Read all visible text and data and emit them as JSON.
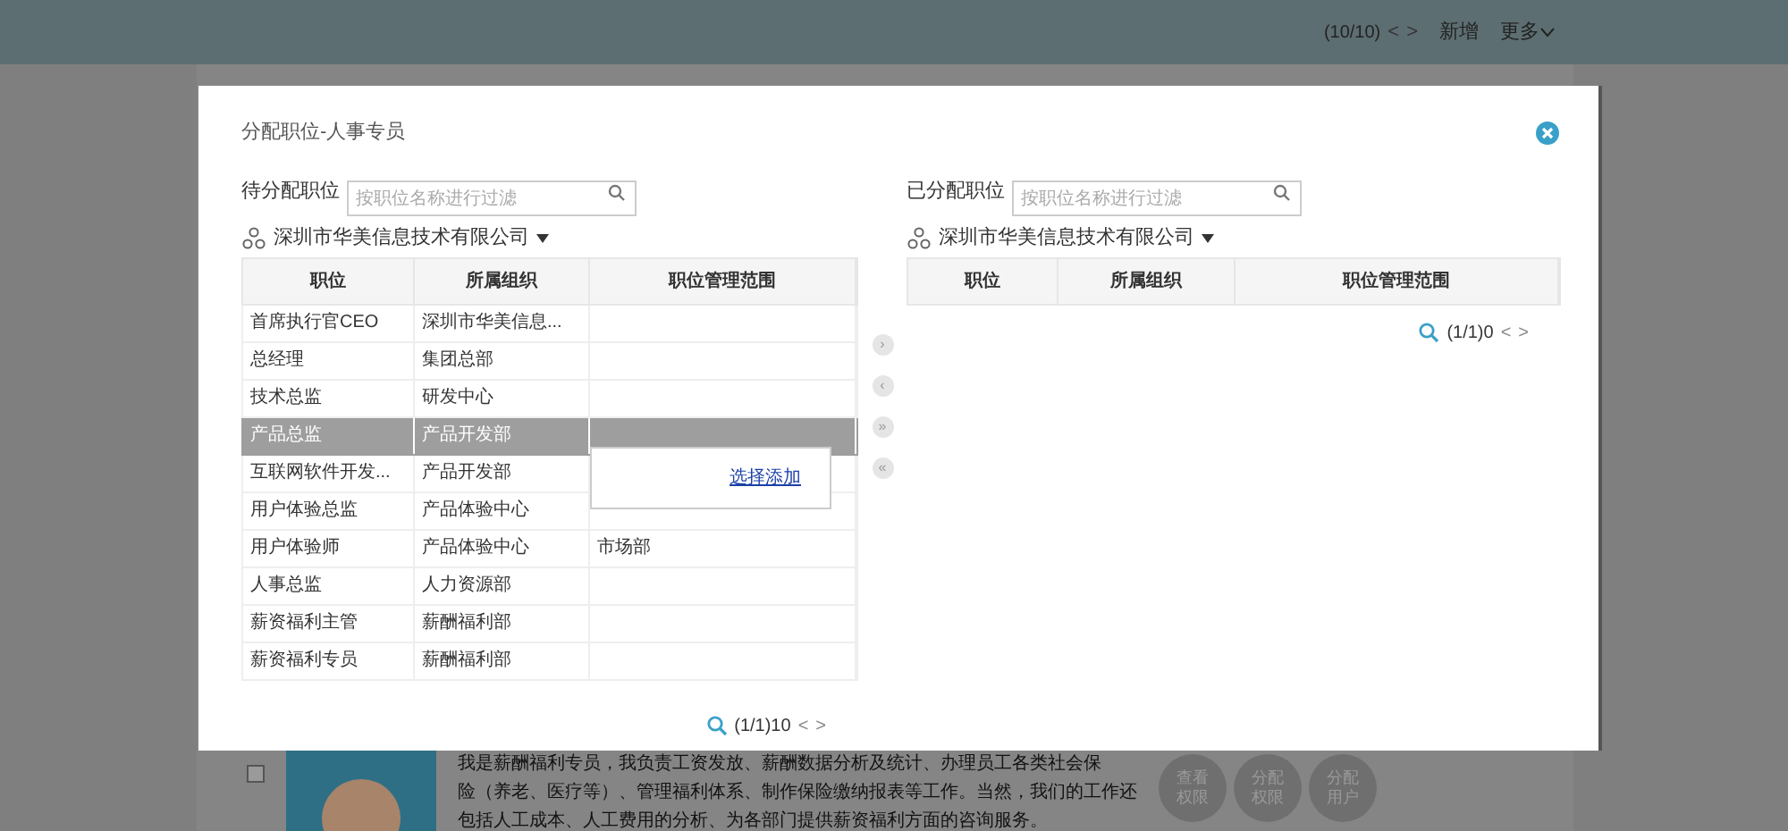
{
  "top_bar": {
    "pager": "(10/10)",
    "prev": "<",
    "next": ">",
    "actions": [
      "新增",
      "更多"
    ]
  },
  "dialog": {
    "title": "分配职位-人事专员",
    "left": {
      "label": "待分配职位",
      "search": {
        "placeholder": "按职位名称进行过滤"
      },
      "org": "深圳市华美信息技术有限公司",
      "columns": [
        "职位",
        "所属组织",
        "职位管理范围"
      ],
      "rows": [
        {
          "position": "首席执行官CEO",
          "org": "深圳市华美信息...",
          "scope": "",
          "selected": false
        },
        {
          "position": "总经理",
          "org": "集团总部",
          "scope": "",
          "selected": false
        },
        {
          "position": "技术总监",
          "org": "研发中心",
          "scope": "",
          "selected": false
        },
        {
          "position": "产品总监",
          "org": "产品开发部",
          "scope": "",
          "selected": true
        },
        {
          "position": "互联网软件开发...",
          "org": "产品开发部",
          "scope": "",
          "selected": false
        },
        {
          "position": "用户体验总监",
          "org": "产品体验中心",
          "scope": "",
          "selected": false
        },
        {
          "position": "用户体验师",
          "org": "产品体验中心",
          "scope": "市场部",
          "selected": false
        },
        {
          "position": "人事总监",
          "org": "人力资源部",
          "scope": "",
          "selected": false
        },
        {
          "position": "薪资福利主管",
          "org": "薪酬福利部",
          "scope": "",
          "selected": false
        },
        {
          "position": "薪资福利专员",
          "org": "薪酬福利部",
          "scope": "",
          "selected": false
        }
      ],
      "popup": {
        "link": "选择添加"
      },
      "pager": {
        "text": "(1/1)10",
        "prev": "<",
        "next": ">"
      }
    },
    "transfer_buttons": [
      "›",
      "‹",
      "»",
      "«"
    ],
    "right": {
      "label": "已分配职位",
      "search": {
        "placeholder": "按职位名称进行过滤"
      },
      "org": "深圳市华美信息技术有限公司",
      "columns": [
        "职位",
        "所属组织",
        "职位管理范围"
      ],
      "pager": {
        "text": "(1/1)0",
        "prev": "<",
        "next": ">"
      }
    }
  },
  "background_card": {
    "checked": false,
    "description": [
      "我是薪酬福利专员，我负责工资发放、薪酬数据分析及统计、办理员工各类社会保",
      "险（养老、医疗等）、管理福利体系、制作保险缴纳报表等工作。当然，我们的工作还",
      "包括人工成本、人工费用的分析、为各部门提供薪资福利方面的咨询服务。"
    ],
    "actions": [
      {
        "line1": "查看",
        "line2": "权限"
      },
      {
        "line1": "分配",
        "line2": "权限"
      },
      {
        "line1": "分配",
        "line2": "用户"
      }
    ]
  }
}
